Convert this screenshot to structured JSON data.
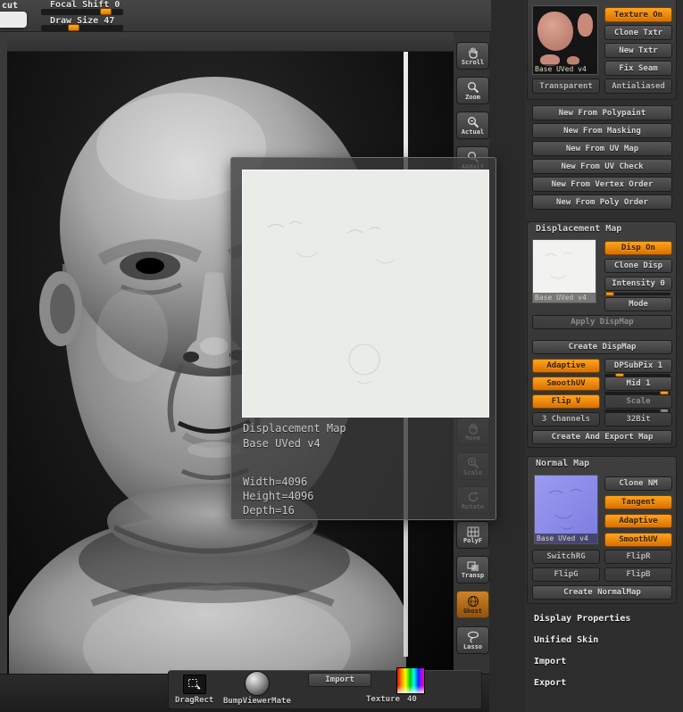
{
  "colors": {
    "accent_orange": "#ff9c00",
    "panel_bg": "#2e2e2e",
    "viewport_bg": "#0a0a0a",
    "button_text": "#d6d6d6"
  },
  "icons": {
    "scroll": "hand-icon",
    "zoom": "magnifier-icon",
    "actual": "magnifier-icon",
    "aahalf": "magnifier-icon",
    "move": "hand-icon",
    "scale": "magnifier-icon",
    "rotate": "rotate-arrow-icon",
    "polyf": "grid-icon",
    "transp": "overlap-squares-icon",
    "ghost": "sphere-icon",
    "lasso": "lasso-icon",
    "dragrect": "drag-rect-icon",
    "bumpviewermate": "sphere-preview-icon",
    "texture_swatch": "rainbow-gradient-swatch"
  },
  "top_bar": {
    "tab": "cut",
    "focal_shift": {
      "label": "Focal Shift",
      "value": "0"
    },
    "draw_size": {
      "label": "Draw Size",
      "value": "47"
    }
  },
  "toolbar": {
    "scroll": "Scroll",
    "zoom": "Zoom",
    "actual": "Actual",
    "aahalf": "AAHalf",
    "move": "Move",
    "scale": "Scale",
    "rotate": "Rotate",
    "polyf": "PolyF",
    "transp": "Transp",
    "ghost": "Ghost",
    "lasso": "Lasso"
  },
  "popup": {
    "title": "Displacement Map",
    "subtitle": "Base UVed v4",
    "width": "Width=4096",
    "height": "Height=4096",
    "depth": "Depth=16"
  },
  "texture_map": {
    "thumb_label": "Base UVed v4",
    "texture_on": "Texture On",
    "clone": "Clone Txtr",
    "new": "New Txtr",
    "fix_seam": "Fix Seam",
    "transparent": "Transparent",
    "antialiased": "Antialiased",
    "new_from": [
      "New From Polypaint",
      "New From Masking",
      "New From UV Map",
      "New From UV Check",
      "New From Vertex Order",
      "New From Poly Order"
    ]
  },
  "displacement_map": {
    "title": "Displacement Map",
    "thumb_label": "Base UVed v4",
    "disp_on": "Disp On",
    "clone": "Clone Disp",
    "intensity": "Intensity 0",
    "mode": "Mode",
    "apply": "Apply DispMap",
    "create": "Create DispMap",
    "adaptive": "Adaptive",
    "dpsubpix": "DPSubPix 1",
    "smoothuv": "SmoothUV",
    "mid": "Mid 1",
    "flipv": "Flip V",
    "scale": "Scale",
    "channels": "3 Channels",
    "bits": "32Bit",
    "create_export": "Create And Export Map"
  },
  "normal_map": {
    "title": "Normal Map",
    "thumb_label": "Base UVed v4",
    "clone": "Clone NM",
    "tangent": "Tangent",
    "adaptive": "Adaptive",
    "smoothuv": "SmoothUV",
    "switchrg": "SwitchRG",
    "flipr": "FlipR",
    "flipg": "FlipG",
    "flipb": "FlipB",
    "create": "Create NormalMap"
  },
  "menu": {
    "display_properties": "Display Properties",
    "unified_skin": "Unified Skin",
    "import": "Import",
    "export": "Export"
  },
  "bottom_bar": {
    "dragrect": "DragRect",
    "bumpviewermate": "BumpViewerMate",
    "import": "Import",
    "texture_label": "Texture",
    "texture_index": "40"
  }
}
